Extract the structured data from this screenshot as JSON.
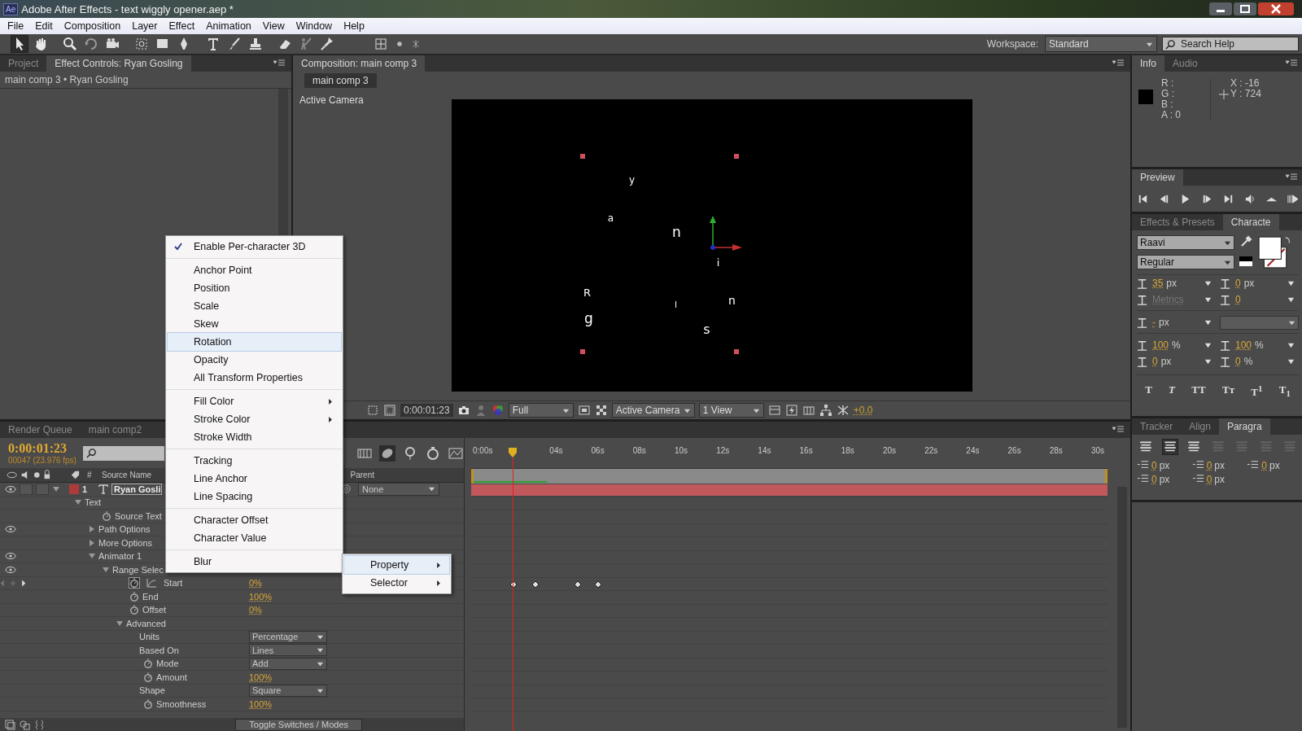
{
  "window": {
    "app_icon": "Ae",
    "title": "Adobe After Effects - text wiggly opener.aep *"
  },
  "menu_bar": [
    "File",
    "Edit",
    "Composition",
    "Layer",
    "Effect",
    "Animation",
    "View",
    "Window",
    "Help"
  ],
  "toolbar": {
    "workspace_label": "Workspace:",
    "workspace": "Standard",
    "search_placeholder": "Search Help"
  },
  "effect_controls": {
    "tabs": [
      {
        "label": "Project",
        "selected": false
      },
      {
        "label": "Effect Controls: Ryan Gosling",
        "selected": true
      }
    ],
    "breadcrumb": "main comp 3 • Ryan Gosling"
  },
  "composition": {
    "tab": "Composition: main comp 3",
    "breadcrumb": "main comp 3",
    "camera_label": "Active Camera",
    "letters": [
      "y",
      "a",
      "n",
      "i",
      "R",
      "g",
      "l",
      "n",
      "s"
    ],
    "viewer_bar": {
      "timecode": "0:00:01:23",
      "resolution": "Full",
      "view": "Active Camera",
      "layout": "1 View",
      "exposure": "+0.0"
    }
  },
  "info": {
    "tabs": [
      {
        "label": "Info",
        "selected": true
      },
      {
        "label": "Audio",
        "selected": false
      }
    ],
    "channels": [
      "R :",
      "G :",
      "B :",
      "A : 0"
    ],
    "x": "X : -16",
    "y": "Y : 724"
  },
  "preview": {
    "tab": "Preview"
  },
  "character": {
    "tabs": [
      {
        "label": "Effects & Presets",
        "selected": false
      },
      {
        "label": "Characte",
        "selected": true
      }
    ],
    "font": "Raavi",
    "style": "Regular",
    "field_rows": [
      [
        {
          "value": "35",
          "unit": "px",
          "disabled": false
        },
        {
          "value": "0",
          "unit": "px",
          "disabled": false
        }
      ],
      [
        {
          "value": "Metrics",
          "disabled": true
        },
        {
          "value": "0",
          "disabled": false
        }
      ],
      [
        {
          "value": "-",
          "unit": "px",
          "disabled": false
        }
      ],
      [
        {
          "value": "100",
          "unit": "%",
          "disabled": false
        },
        {
          "value": "100",
          "unit": "%",
          "disabled": false
        }
      ],
      [
        {
          "value": "0",
          "unit": "px",
          "disabled": false
        },
        {
          "value": "0",
          "unit": "%",
          "disabled": false
        }
      ]
    ],
    "styles": [
      "T",
      "T",
      "TT",
      "Tᴛ",
      "T$^{1}$",
      "T$_{1}$"
    ]
  },
  "paragraph": {
    "tabs": [
      {
        "label": "Tracker",
        "selected": false
      },
      {
        "label": "Align",
        "selected": false
      },
      {
        "label": "Paragra",
        "selected": true
      }
    ],
    "alignments": [
      {
        "selected": false,
        "disabled": false
      },
      {
        "selected": true,
        "disabled": false
      },
      {
        "selected": false,
        "disabled": false
      },
      {
        "selected": false,
        "disabled": true
      },
      {
        "selected": false,
        "disabled": true
      },
      {
        "selected": false,
        "disabled": true
      },
      {
        "selected": false,
        "disabled": true
      }
    ],
    "indents": [
      {
        "value": "0",
        "unit": "px"
      },
      {
        "value": "0",
        "unit": "px"
      },
      {
        "value": "0",
        "unit": "px"
      },
      {
        "value": "0",
        "unit": "px"
      },
      {
        "value": "0",
        "unit": "px"
      }
    ]
  },
  "timeline": {
    "tabs": [
      {
        "label": "Render Queue",
        "selected": false
      },
      {
        "label": "main comp2",
        "selected": false
      }
    ],
    "timecode": "0:00:01:23",
    "frame_info": "00047 (23.976 fps)",
    "columns": {
      "number": "#",
      "source_name": "Source Name",
      "parent": "Parent"
    },
    "layers": [
      {
        "number": "1",
        "name": "Ryan Gosli",
        "parent": "None",
        "eye": true,
        "expanded": true,
        "children": [
          {
            "name": "Text",
            "eye": false,
            "expanded": true,
            "children": [
              {
                "name": "Source Text",
                "eye": false,
                "stopwatch": true
              },
              {
                "name": "Path Options",
                "eye": true,
                "expanded": false
              },
              {
                "name": "More Options",
                "eye": false,
                "expanded": false
              },
              {
                "name": "Animator 1",
                "eye": true,
                "expanded": true,
                "children": [
                  {
                    "name": "Range Selec",
                    "eye": true,
                    "expanded": true,
                    "children": [
                      {
                        "name": "Start",
                        "eye": false,
                        "stopwatch": true,
                        "keyframed": true,
                        "value": "0%"
                      },
                      {
                        "name": "End",
                        "eye": false,
                        "stopwatch": true,
                        "value": "100%"
                      },
                      {
                        "name": "Offset",
                        "eye": false,
                        "stopwatch": true,
                        "value": "0%"
                      },
                      {
                        "name": "Advanced",
                        "eye": false,
                        "expanded": true,
                        "children": [
                          {
                            "name": "Units",
                            "eye": false,
                            "stopwatch": false,
                            "dropdown": "Percentage"
                          },
                          {
                            "name": "Based On",
                            "eye": false,
                            "stopwatch": false,
                            "dropdown": "Lines"
                          },
                          {
                            "name": "Mode",
                            "eye": false,
                            "stopwatch": true,
                            "dropdown": "Add"
                          },
                          {
                            "name": "Amount",
                            "eye": false,
                            "stopwatch": true,
                            "value": "100%"
                          },
                          {
                            "name": "Shape",
                            "eye": false,
                            "stopwatch": false,
                            "dropdown": "Square"
                          },
                          {
                            "name": "Smoothness",
                            "eye": false,
                            "stopwatch": true,
                            "value": "100%"
                          }
                        ]
                      }
                    ]
                  }
                ]
              }
            ]
          }
        ]
      }
    ],
    "ruler": [
      "0:00s",
      "04s",
      "06s",
      "08s",
      "10s",
      "12s",
      "14s",
      "16s",
      "18s",
      "20s",
      "22s",
      "24s",
      "26s",
      "28s",
      "30s"
    ],
    "footer_button": "Toggle Switches / Modes"
  },
  "context_menu": {
    "groups": [
      [
        {
          "label": "Enable Per-character 3D",
          "checked": true,
          "selected": false,
          "submenu": false
        }
      ],
      [
        {
          "label": "Anchor Point",
          "checked": false,
          "selected": false,
          "submenu": false
        },
        {
          "label": "Position",
          "checked": false,
          "selected": false,
          "submenu": false
        },
        {
          "label": "Scale",
          "checked": false,
          "selected": false,
          "submenu": false
        },
        {
          "label": "Skew",
          "checked": false,
          "selected": false,
          "submenu": false
        },
        {
          "label": "Rotation",
          "checked": false,
          "selected": true,
          "submenu": false
        },
        {
          "label": "Opacity",
          "checked": false,
          "selected": false,
          "submenu": false
        },
        {
          "label": "All Transform Properties",
          "checked": false,
          "selected": false,
          "submenu": false
        }
      ],
      [
        {
          "label": "Fill Color",
          "checked": false,
          "selected": false,
          "submenu": true
        },
        {
          "label": "Stroke Color",
          "checked": false,
          "selected": false,
          "submenu": true
        },
        {
          "label": "Stroke Width",
          "checked": false,
          "selected": false,
          "submenu": false
        }
      ],
      [
        {
          "label": "Tracking",
          "checked": false,
          "selected": false,
          "submenu": false
        },
        {
          "label": "Line Anchor",
          "checked": false,
          "selected": false,
          "submenu": false
        },
        {
          "label": "Line Spacing",
          "checked": false,
          "selected": false,
          "submenu": false
        }
      ],
      [
        {
          "label": "Character Offset",
          "checked": false,
          "selected": false,
          "submenu": false
        },
        {
          "label": "Character Value",
          "checked": false,
          "selected": false,
          "submenu": false
        }
      ],
      [
        {
          "label": "Blur",
          "checked": false,
          "selected": false,
          "submenu": false
        }
      ]
    ]
  },
  "submenu": {
    "items": [
      {
        "label": "Property",
        "selected": true,
        "arrow": true
      },
      {
        "label": "Selector",
        "selected": false,
        "arrow": true
      }
    ]
  }
}
